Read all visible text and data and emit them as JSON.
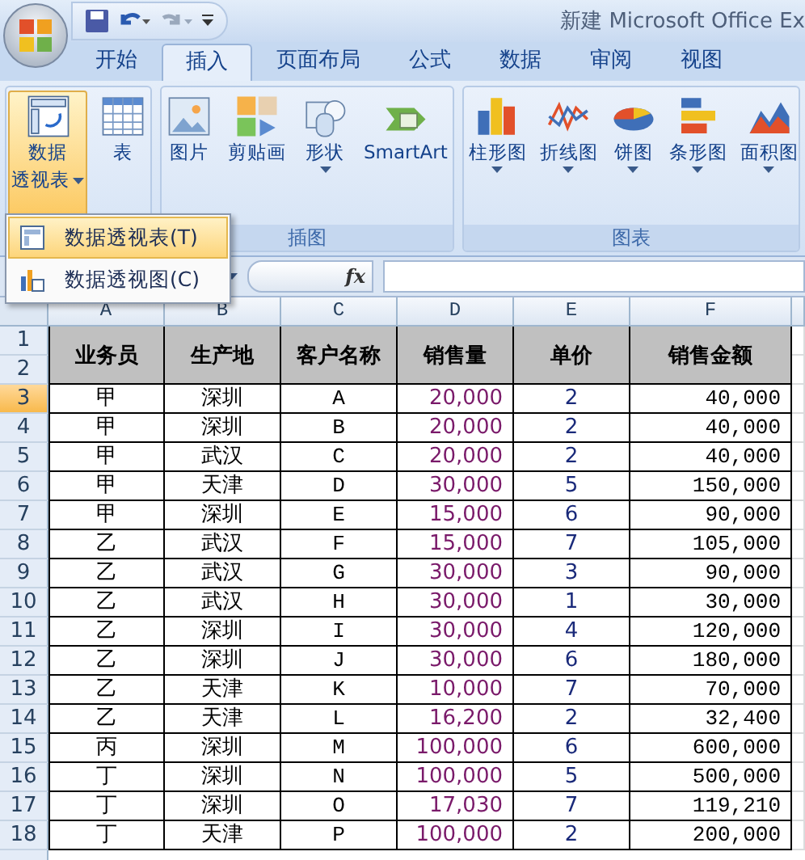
{
  "title_bar": {
    "title": "新建 Microsoft Office Ex"
  },
  "tabs": [
    {
      "label": "开始",
      "selected": false
    },
    {
      "label": "插入",
      "selected": true
    },
    {
      "label": "页面布局",
      "selected": false
    },
    {
      "label": "公式",
      "selected": false
    },
    {
      "label": "数据",
      "selected": false
    },
    {
      "label": "审阅",
      "selected": false
    },
    {
      "label": "视图",
      "selected": false
    }
  ],
  "ribbon": {
    "groups": [
      {
        "buttons": [
          {
            "lines": [
              "数据",
              "透视表"
            ],
            "dropdown": true,
            "highlighted": true
          },
          {
            "lines": [
              "表"
            ],
            "dropdown": false,
            "highlighted": false
          }
        ]
      },
      {
        "label": "插图",
        "buttons": [
          {
            "lines": [
              "图片"
            ],
            "dropdown": false,
            "highlighted": false
          },
          {
            "lines": [
              "剪贴画"
            ],
            "dropdown": false,
            "highlighted": false
          },
          {
            "lines": [
              "形状"
            ],
            "dropdown": true,
            "highlighted": false
          },
          {
            "lines": [
              "SmartArt"
            ],
            "dropdown": false,
            "highlighted": false
          }
        ]
      },
      {
        "label": "图表",
        "buttons": [
          {
            "lines": [
              "柱形图"
            ],
            "dropdown": true,
            "highlighted": false
          },
          {
            "lines": [
              "折线图"
            ],
            "dropdown": true,
            "highlighted": false
          },
          {
            "lines": [
              "饼图"
            ],
            "dropdown": true,
            "highlighted": false
          },
          {
            "lines": [
              "条形图"
            ],
            "dropdown": true,
            "highlighted": false
          },
          {
            "lines": [
              "面积图"
            ],
            "dropdown": true,
            "highlighted": false
          }
        ]
      }
    ]
  },
  "menu": {
    "items": [
      {
        "label": "数据透视表(T)",
        "selected": true
      },
      {
        "label": "数据透视图(C)",
        "selected": false
      }
    ]
  },
  "formula_bar": {
    "fx_label": "fx"
  },
  "sheet": {
    "columns": [
      "A",
      "B",
      "C",
      "D",
      "E",
      "F"
    ],
    "header_rows": [
      "1",
      "2"
    ],
    "headers": [
      "业务员",
      "生产地",
      "客户名称",
      "销售量",
      "单价",
      "销售金额"
    ],
    "rows": [
      {
        "number": "3",
        "selected": true,
        "cells": [
          "甲",
          "深圳",
          "A",
          "20,000",
          "2",
          "40,000"
        ]
      },
      {
        "number": "4",
        "selected": false,
        "cells": [
          "甲",
          "深圳",
          "B",
          "20,000",
          "2",
          "40,000"
        ]
      },
      {
        "number": "5",
        "selected": false,
        "cells": [
          "甲",
          "武汉",
          "C",
          "20,000",
          "2",
          "40,000"
        ]
      },
      {
        "number": "6",
        "selected": false,
        "cells": [
          "甲",
          "天津",
          "D",
          "30,000",
          "5",
          "150,000"
        ]
      },
      {
        "number": "7",
        "selected": false,
        "cells": [
          "甲",
          "深圳",
          "E",
          "15,000",
          "6",
          "90,000"
        ]
      },
      {
        "number": "8",
        "selected": false,
        "cells": [
          "乙",
          "武汉",
          "F",
          "15,000",
          "7",
          "105,000"
        ]
      },
      {
        "number": "9",
        "selected": false,
        "cells": [
          "乙",
          "武汉",
          "G",
          "30,000",
          "3",
          "90,000"
        ]
      },
      {
        "number": "10",
        "selected": false,
        "cells": [
          "乙",
          "武汉",
          "H",
          "30,000",
          "1",
          "30,000"
        ]
      },
      {
        "number": "11",
        "selected": false,
        "cells": [
          "乙",
          "深圳",
          "I",
          "30,000",
          "4",
          "120,000"
        ]
      },
      {
        "number": "12",
        "selected": false,
        "cells": [
          "乙",
          "深圳",
          "J",
          "30,000",
          "6",
          "180,000"
        ]
      },
      {
        "number": "13",
        "selected": false,
        "cells": [
          "乙",
          "天津",
          "K",
          "10,000",
          "7",
          "70,000"
        ]
      },
      {
        "number": "14",
        "selected": false,
        "cells": [
          "乙",
          "天津",
          "L",
          "16,200",
          "2",
          "32,400"
        ]
      },
      {
        "number": "15",
        "selected": false,
        "cells": [
          "丙",
          "深圳",
          "M",
          "100,000",
          "6",
          "600,000"
        ]
      },
      {
        "number": "16",
        "selected": false,
        "cells": [
          "丁",
          "深圳",
          "N",
          "100,000",
          "5",
          "500,000"
        ]
      },
      {
        "number": "17",
        "selected": false,
        "cells": [
          "丁",
          "深圳",
          "O",
          "17,030",
          "7",
          "119,210"
        ]
      },
      {
        "number": "18",
        "selected": false,
        "cells": [
          "丁",
          "天津",
          "P",
          "100,000",
          "2",
          "200,000"
        ]
      }
    ]
  }
}
